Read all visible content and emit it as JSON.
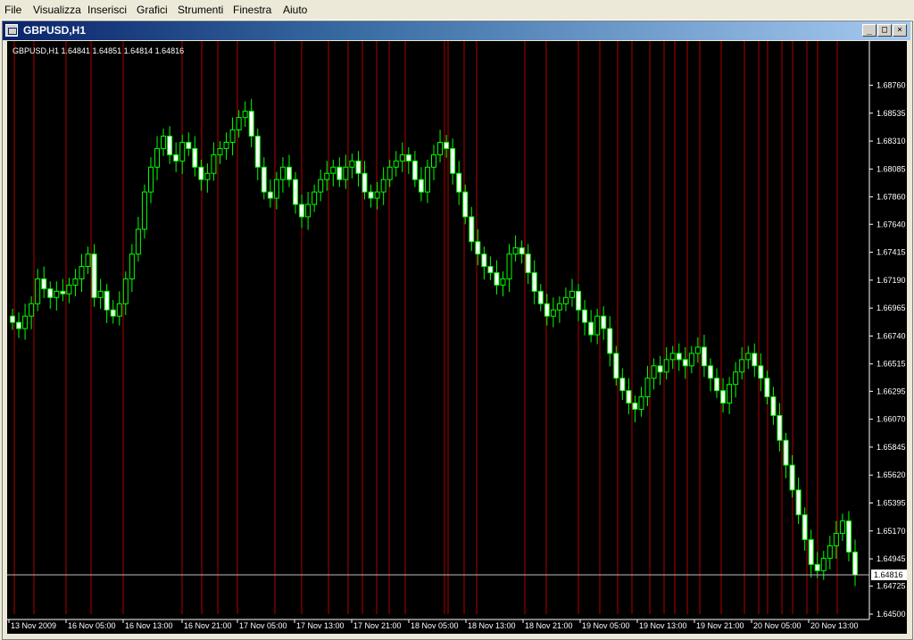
{
  "menu": {
    "items": [
      {
        "label": "File"
      },
      {
        "label": "Visualizza"
      },
      {
        "label": "Inserisci"
      },
      {
        "label": "Grafici"
      },
      {
        "label": "Strumenti"
      },
      {
        "label": "Finestra"
      },
      {
        "label": "Aiuto"
      }
    ]
  },
  "window": {
    "title": "GBPUSD,H1",
    "buttons": {
      "minimize": "_",
      "maximize": "□",
      "close": "×"
    }
  },
  "chart_info": {
    "symbol": "GBPUSD,H1",
    "ohlc": "1.64841 1.64851 1.64814 1.64816"
  },
  "colors": {
    "background": "#000000",
    "bull_candle": "#ffffff",
    "wick": "#00ff00",
    "separator": "#ff0000",
    "axis": "#ffffff",
    "current_price_line": "#c0c0c0"
  },
  "chart_data": {
    "type": "candlestick",
    "title": "",
    "ylim": [
      1.645,
      1.689
    ],
    "y_ticks": [
      "1.68760",
      "1.68535",
      "1.68310",
      "1.68085",
      "1.67860",
      "1.67640",
      "1.67415",
      "1.67190",
      "1.66965",
      "1.66740",
      "1.66515",
      "1.66295",
      "1.66070",
      "1.65845",
      "1.65620",
      "1.65395",
      "1.65170",
      "1.64945",
      "1.64725",
      "1.64500"
    ],
    "x_ticks": [
      "13 Nov 2009",
      "16 Nov 05:00",
      "16 Nov 13:00",
      "16 Nov 21:00",
      "17 Nov 05:00",
      "17 Nov 13:00",
      "17 Nov 21:00",
      "18 Nov 05:00",
      "18 Nov 13:00",
      "18 Nov 21:00",
      "19 Nov 05:00",
      "19 Nov 13:00",
      "19 Nov 21:00",
      "20 Nov 05:00",
      "20 Nov 13:00"
    ],
    "current_price": "1.64816",
    "close_path": [
      1.6685,
      1.668,
      1.669,
      1.67,
      1.672,
      1.6712,
      1.6705,
      1.671,
      1.6708,
      1.6715,
      1.672,
      1.673,
      1.674,
      1.6705,
      1.671,
      1.6695,
      1.669,
      1.67,
      1.672,
      1.674,
      1.676,
      1.679,
      1.681,
      1.6825,
      1.6835,
      1.682,
      1.6815,
      1.683,
      1.6825,
      1.681,
      1.68,
      1.6805,
      1.682,
      1.6825,
      1.683,
      1.684,
      1.685,
      1.6855,
      1.6835,
      1.681,
      1.679,
      1.6785,
      1.68,
      1.681,
      1.68,
      1.678,
      1.677,
      1.678,
      1.679,
      1.68,
      1.6805,
      1.681,
      1.68,
      1.681,
      1.6815,
      1.6805,
      1.679,
      1.6785,
      1.679,
      1.68,
      1.681,
      1.6815,
      1.682,
      1.6815,
      1.68,
      1.679,
      1.681,
      1.682,
      1.683,
      1.6825,
      1.6805,
      1.679,
      1.677,
      1.675,
      1.674,
      1.673,
      1.6725,
      1.6715,
      1.672,
      1.674,
      1.6745,
      1.674,
      1.6725,
      1.671,
      1.67,
      1.669,
      1.6695,
      1.67,
      1.6705,
      1.671,
      1.6695,
      1.6685,
      1.6675,
      1.669,
      1.668,
      1.666,
      1.664,
      1.663,
      1.662,
      1.6615,
      1.6625,
      1.664,
      1.665,
      1.6645,
      1.6655,
      1.666,
      1.6655,
      1.665,
      1.666,
      1.6665,
      1.665,
      1.664,
      1.663,
      1.662,
      1.6635,
      1.6645,
      1.6655,
      1.666,
      1.665,
      1.664,
      1.6625,
      1.661,
      1.659,
      1.657,
      1.655,
      1.653,
      1.651,
      1.649,
      1.6485,
      1.6495,
      1.6505,
      1.6515,
      1.6525,
      1.65,
      1.64816
    ]
  }
}
